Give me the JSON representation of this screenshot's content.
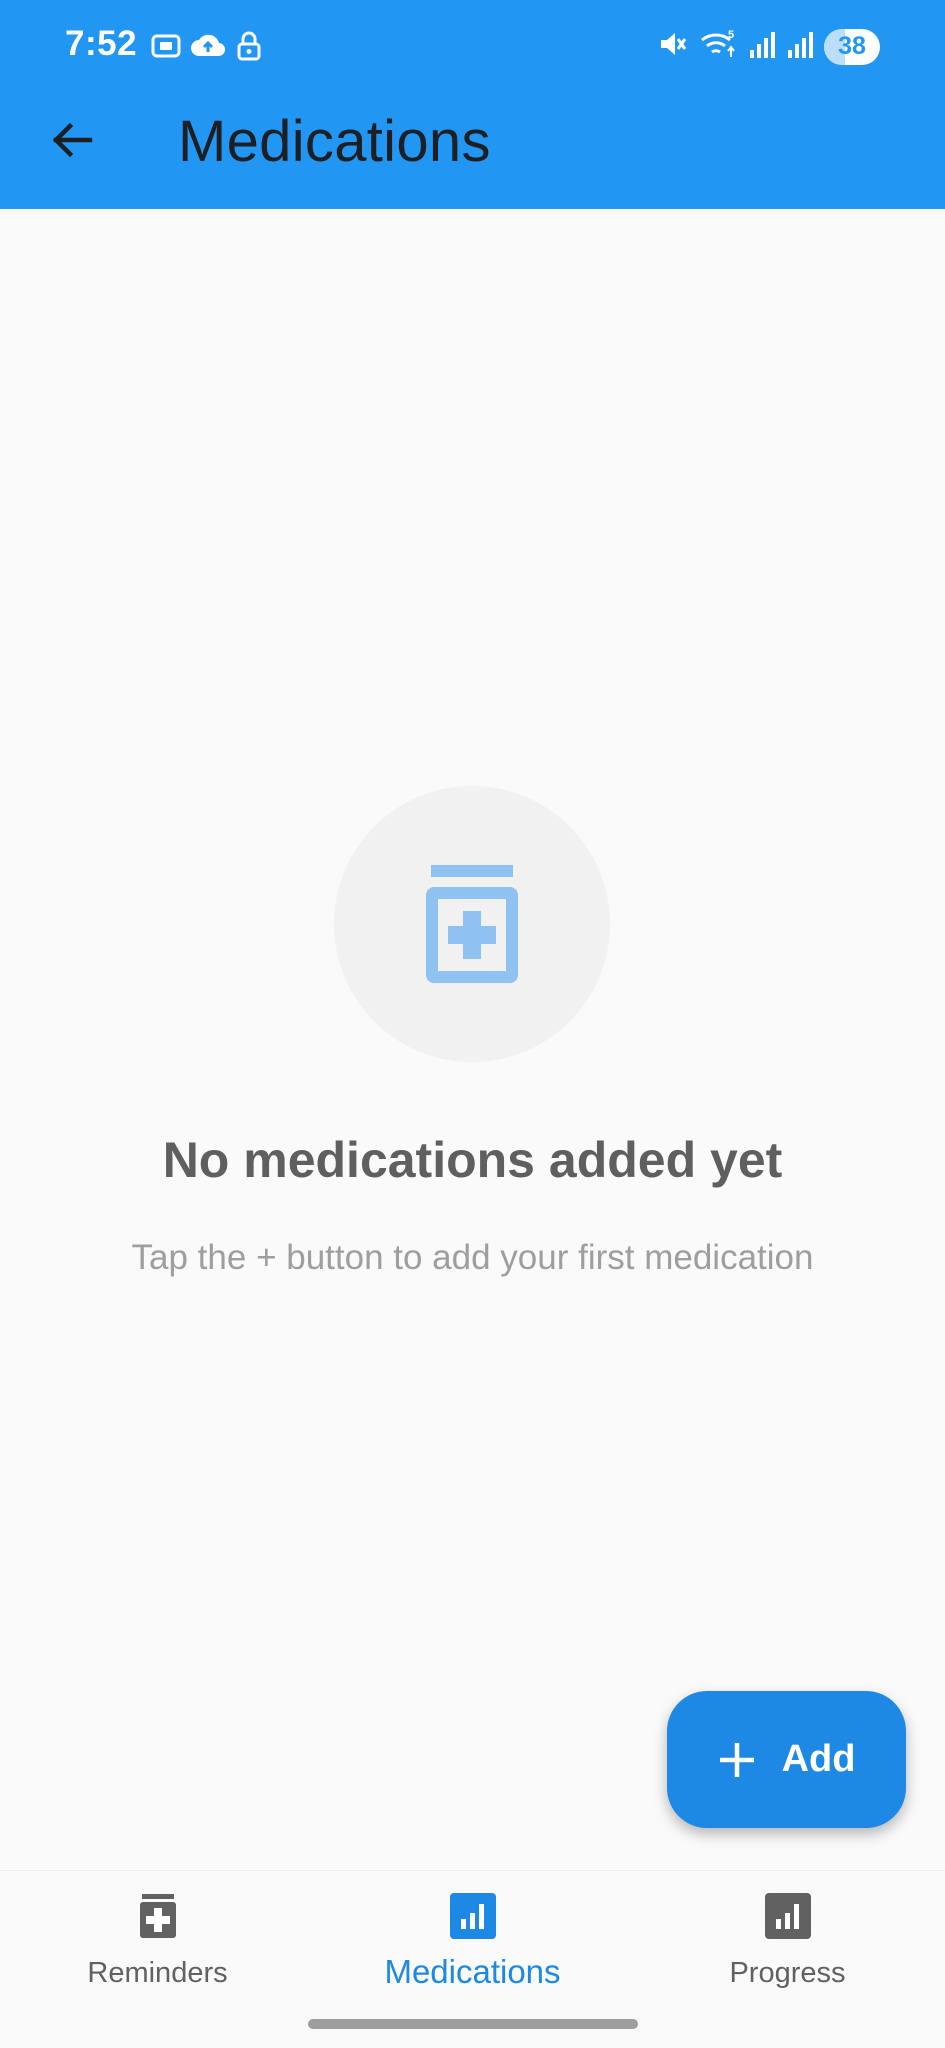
{
  "status_bar": {
    "time": "7:52",
    "battery": "38",
    "battery_level": 0.38,
    "icons": [
      "screenshot-icon",
      "cloud-upload-icon",
      "lock-icon",
      "mute-icon",
      "wifi-icon",
      "signal-icon",
      "signal-icon"
    ]
  },
  "app_bar": {
    "title": "Medications",
    "back_icon": "arrow-back-icon",
    "color": "#2196f3"
  },
  "empty_state": {
    "icon": "medication-icon",
    "title": "No medications added yet",
    "subtitle": "Tap the + button to add your first medication"
  },
  "fab": {
    "label": "Add",
    "icon": "plus-icon",
    "color": "#1e88e5"
  },
  "bottom_nav": {
    "items": [
      {
        "label": "Reminders",
        "icon": "medication-icon",
        "active": false
      },
      {
        "label": "Medications",
        "icon": "bar-chart-icon",
        "active": true
      },
      {
        "label": "Progress",
        "icon": "bar-chart-icon",
        "active": false
      }
    ],
    "active_color": "#1e88e5",
    "inactive_color": "#616161"
  }
}
